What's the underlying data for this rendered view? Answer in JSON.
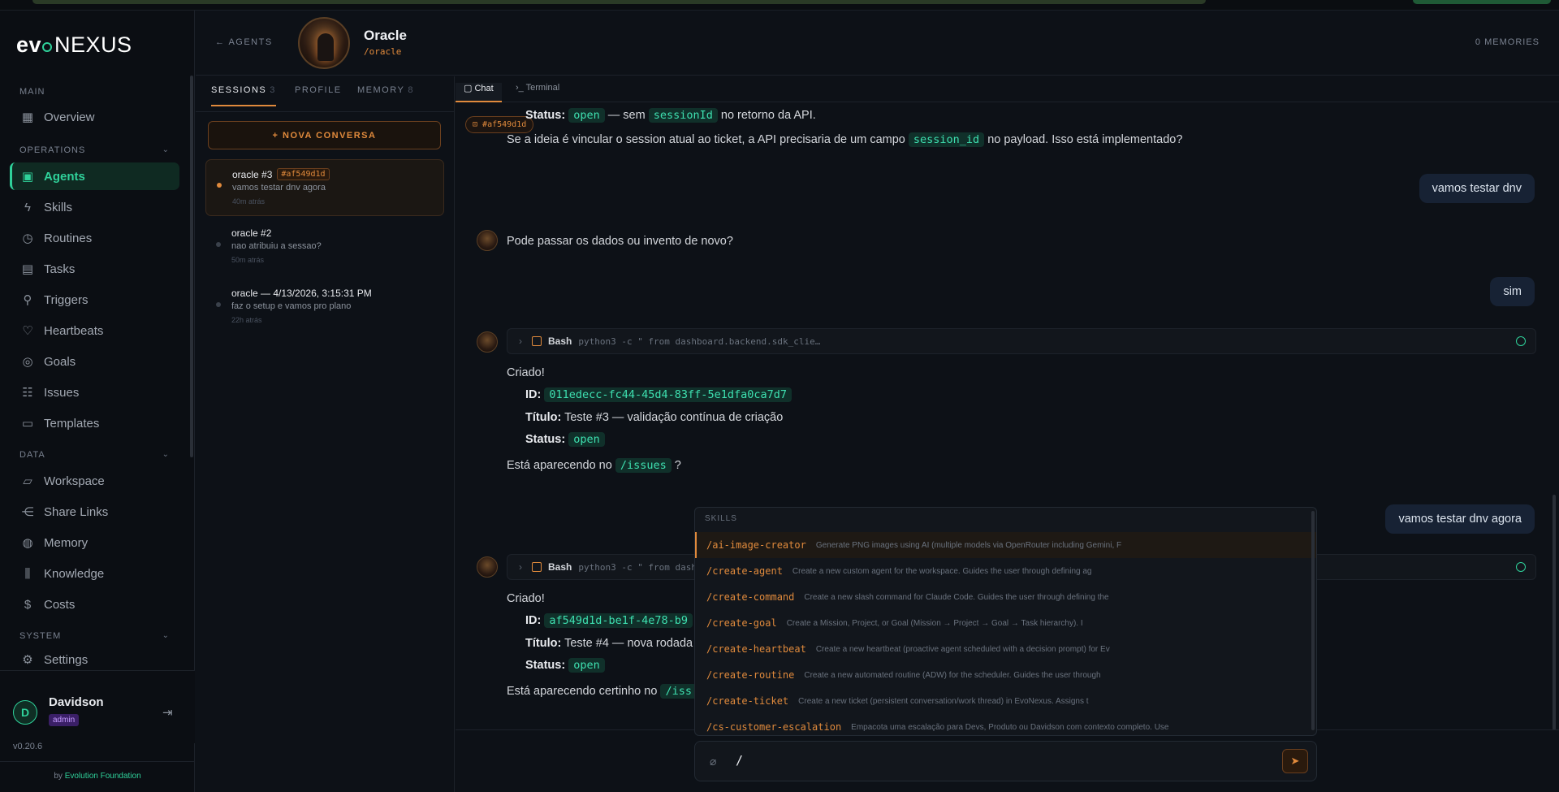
{
  "brand": {
    "logo_left": "evo",
    "logo_right": "NEXUS",
    "accent": "#2fd19a",
    "orange": "#e08a3c"
  },
  "sidebar": {
    "main_label": "MAIN",
    "overview": "Overview",
    "operations_label": "OPERATIONS",
    "operations": [
      "Agents",
      "Skills",
      "Routines",
      "Tasks",
      "Triggers",
      "Heartbeats",
      "Goals",
      "Issues",
      "Templates"
    ],
    "data_label": "DATA",
    "data": [
      "Workspace",
      "Share Links",
      "Memory",
      "Knowledge",
      "Costs"
    ],
    "system_label": "SYSTEM",
    "settings": "Settings",
    "user": {
      "initial": "D",
      "name": "Davidson",
      "role": "admin"
    },
    "version": "v0.20.6",
    "by": "by",
    "org": "Evolution Foundation"
  },
  "header": {
    "back": "← AGENTS",
    "agent_name": "Oracle",
    "agent_slug": "/oracle",
    "memories": "0 MEMORIES"
  },
  "sessions": {
    "tabs": [
      {
        "label": "SESSIONS",
        "count": "3"
      },
      {
        "label": "PROFILE",
        "count": ""
      },
      {
        "label": "MEMORY",
        "count": "8"
      }
    ],
    "new_button": "+ NOVA CONVERSA",
    "items": [
      {
        "title": "oracle #3",
        "tag": "#af549d1d",
        "preview": "vamos testar dnv agora",
        "ago": "40m atrás"
      },
      {
        "title": "oracle #2",
        "tag": "",
        "preview": "nao atribuiu a sessao?",
        "ago": "50m atrás"
      },
      {
        "title": "oracle — 4/13/2026, 3:15:31 PM",
        "tag": "",
        "preview": "faz o setup e vamos pro plano",
        "ago": "22h atrás"
      }
    ]
  },
  "chat": {
    "tabs": [
      "Chat",
      "Terminal"
    ],
    "session_tag": "#af549d1d",
    "m1_status_label": "Status:",
    "m1_status_val": "open",
    "m1_mid": "— sem",
    "m1_code": "sessionId",
    "m1_end": "no retorno da API.",
    "m2_a": "Se a ideia é vincular o session atual ao ticket, a API precisaria de um campo",
    "m2_code": "session_id",
    "m2_b": "no payload. Isso está implementado?",
    "u1": "vamos testar dnv",
    "a1": "Pode passar os dados ou invento de novo?",
    "u2": "sim",
    "tool1": {
      "name": "Bash",
      "cmd": "python3 -c \" from dashboard.backend.sdk_clie…"
    },
    "c1_title": "Criado!",
    "c1_id_label": "ID:",
    "c1_id": "011edecc-fc44-45d4-83ff-5e1dfa0ca7d7",
    "c1_titulo_label": "Título:",
    "c1_titulo": "Teste #3 — validação contínua de criação",
    "c1_status_label": "Status:",
    "c1_status": "open",
    "c1_q_a": "Está aparecendo no",
    "c1_q_code": "/issues",
    "c1_q_b": "?",
    "u3": "vamos testar dnv agora",
    "tool2": {
      "name": "Bash",
      "cmd": "python3 -c \" from dash"
    },
    "c2_title": "Criado!",
    "c2_id_label": "ID:",
    "c2_id": "af549d1d-be1f-4e78-b9",
    "c2_titulo_label": "Título:",
    "c2_titulo": "Teste #4 — nova rodada",
    "c2_status_label": "Status:",
    "c2_status": "open",
    "c2_q_a": "Está aparecendo certinho no",
    "c2_q_code": "/iss"
  },
  "dropdown": {
    "header": "SKILLS",
    "items": [
      {
        "cmd": "/ai-image-creator",
        "desc": "Generate PNG images using AI (multiple models via OpenRouter including Gemini, F"
      },
      {
        "cmd": "/create-agent",
        "desc": "Create a new custom agent for the workspace. Guides the user through defining ag"
      },
      {
        "cmd": "/create-command",
        "desc": "Create a new slash command for Claude Code. Guides the user through defining the"
      },
      {
        "cmd": "/create-goal",
        "desc": "Create a Mission, Project, or Goal (Mission → Project → Goal → Task hierarchy). I"
      },
      {
        "cmd": "/create-heartbeat",
        "desc": "Create a new heartbeat (proactive agent scheduled with a decision prompt) for Ev"
      },
      {
        "cmd": "/create-routine",
        "desc": "Create a new automated routine (ADW) for the scheduler. Guides the user through"
      },
      {
        "cmd": "/create-ticket",
        "desc": "Create a new ticket (persistent conversation/work thread) in EvoNexus. Assigns t"
      },
      {
        "cmd": "/cs-customer-escalation",
        "desc": "Empacota uma escalação para Devs, Produto ou Davidson com contexto completo. Use"
      }
    ]
  },
  "input": {
    "value": "/"
  }
}
